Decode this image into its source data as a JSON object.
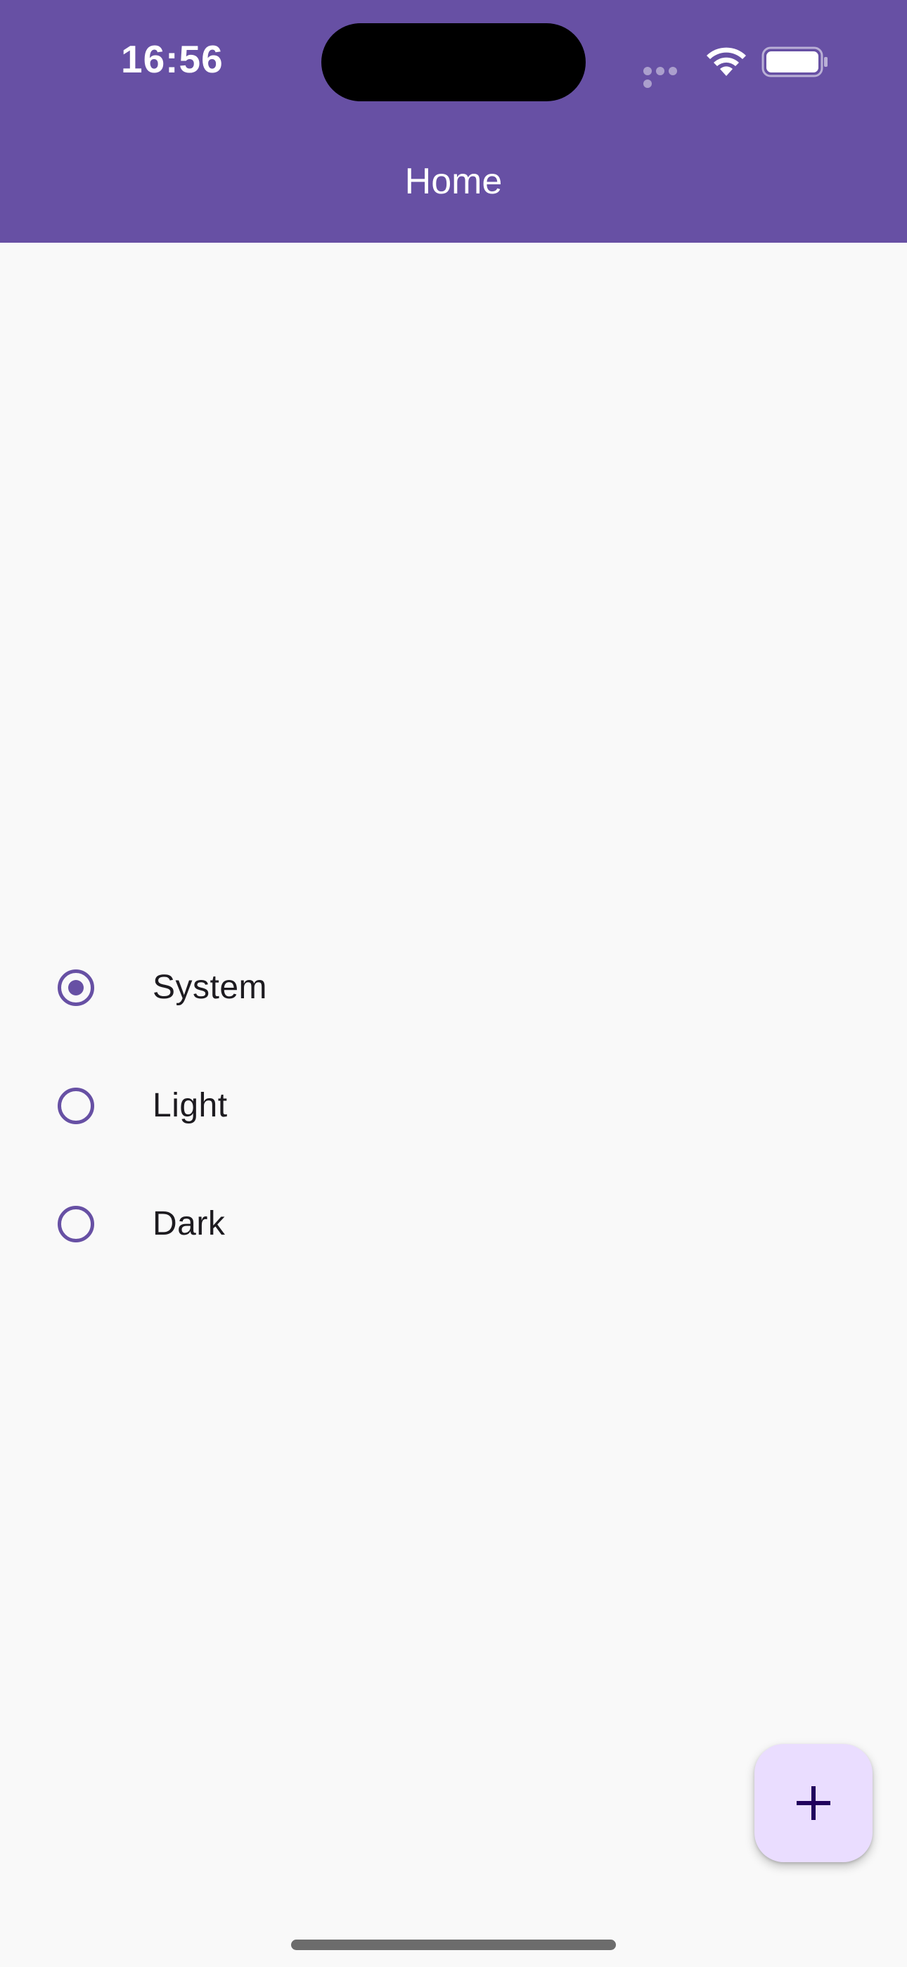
{
  "status_bar": {
    "time": "16:56",
    "icons": [
      "signal-icon",
      "wifi-icon",
      "battery-icon"
    ]
  },
  "app_bar": {
    "title": "Home",
    "background_color": "#6750a4"
  },
  "theme_options": {
    "selected": "System",
    "items": [
      {
        "label": "System",
        "selected": true
      },
      {
        "label": "Light",
        "selected": false
      },
      {
        "label": "Dark",
        "selected": false
      }
    ],
    "accent_color": "#6750a4"
  },
  "fab": {
    "icon": "plus-icon",
    "background_color": "#eaddff"
  }
}
